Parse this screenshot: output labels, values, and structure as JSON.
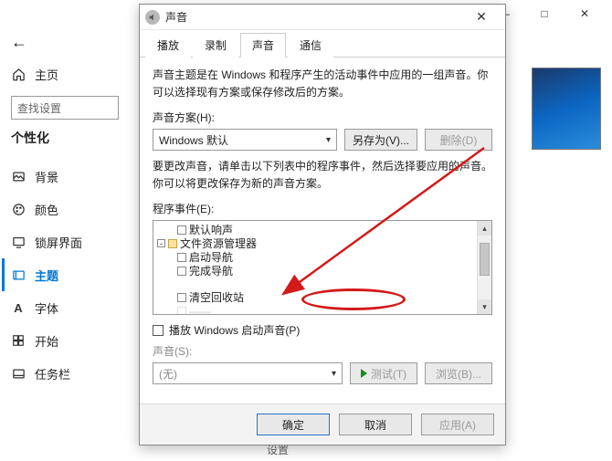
{
  "settings": {
    "back_icon": "←",
    "search_placeholder": "查找设置",
    "section": "个性化",
    "nav": {
      "home": "主页",
      "background": "背景",
      "colors": "颜色",
      "lockscreen": "锁屏界面",
      "themes": "主题",
      "fonts": "字体",
      "start": "开始",
      "taskbar": "任务栏"
    },
    "win_buttons": {
      "min": "—",
      "max": "□",
      "close": "✕"
    }
  },
  "sound": {
    "title": "声音",
    "tabs": {
      "play": "播放",
      "record": "录制",
      "sounds": "声音",
      "comm": "通信"
    },
    "intro": "声音主题是在 Windows 和程序产生的活动事件中应用的一组声音。你可以选择现有方案或保存修改后的方案。",
    "scheme_label": "声音方案(H):",
    "scheme_value": "Windows 默认",
    "save_as": "另存为(V)...",
    "delete": "删除(D)",
    "desc2": "要更改声音，请单击以下列表中的程序事件，然后选择要应用的声音。你可以将更改保存为新的声音方案。",
    "events_label": "程序事件(E):",
    "events": {
      "default_beep": "默认响声",
      "explorer": "文件资源管理器",
      "nav_start": "启动导航",
      "nav_done": "完成导航",
      "empty_recycle": "清空回收站"
    },
    "play_startup": "播放 Windows 启动声音(P)",
    "sound_label": "声音(S):",
    "sound_value": "(无)",
    "test": "测试(T)",
    "browse": "浏览(B)...",
    "ok": "确定",
    "cancel": "取消",
    "apply": "应用(A)",
    "close_x": "✕"
  },
  "footer_hint": "设置"
}
